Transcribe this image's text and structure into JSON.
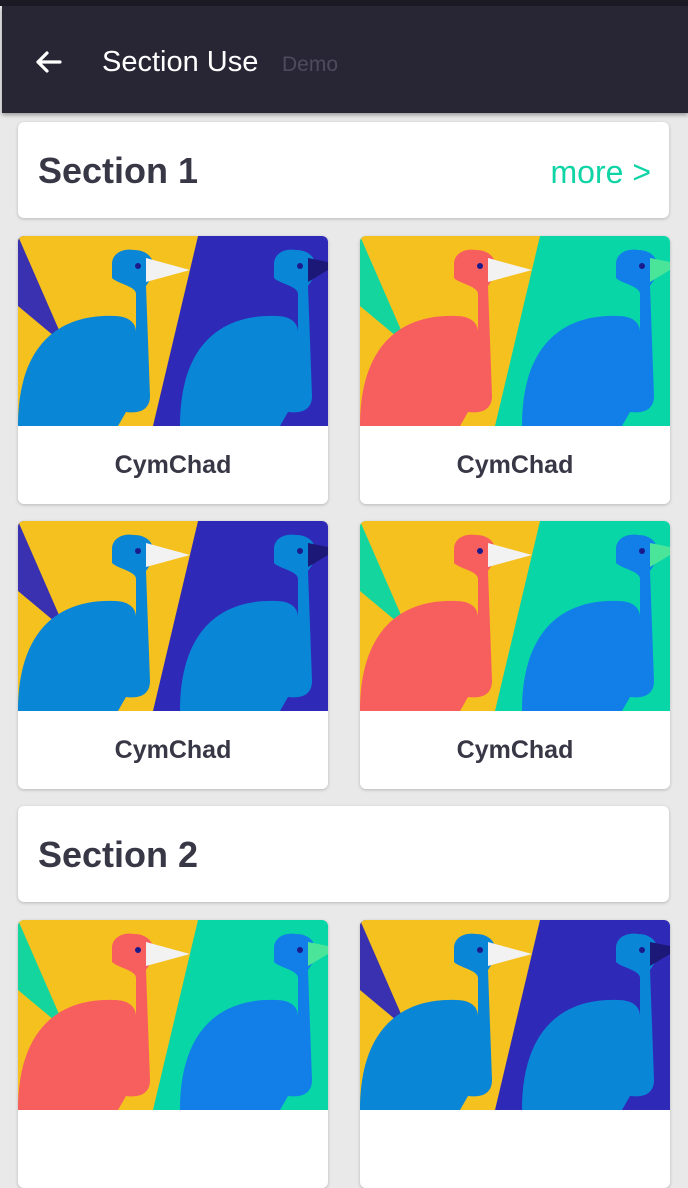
{
  "toolbar": {
    "title": "Section Use",
    "subtitle": "Demo"
  },
  "sections": [
    {
      "title": "Section 1",
      "more_label": "more >",
      "items": [
        {
          "label": "CymChad",
          "variant": "blue"
        },
        {
          "label": "CymChad",
          "variant": "teal"
        },
        {
          "label": "CymChad",
          "variant": "blue"
        },
        {
          "label": "CymChad",
          "variant": "teal"
        }
      ]
    },
    {
      "title": "Section 2",
      "items": [
        {
          "variant": "teal"
        },
        {
          "variant": "blue"
        }
      ]
    }
  ],
  "illustration_palettes": {
    "blue": {
      "corner": "#2f29b8",
      "left_bg": "#f5c11e",
      "right_bg": "#2f29b8",
      "left_bird": "#0a86d6",
      "right_bird": "#0a86d6",
      "beak_right": "#1c1878"
    },
    "teal": {
      "corner": "#08d6a6",
      "left_bg": "#f5c11e",
      "right_bg": "#08d6a6",
      "left_bird": "#f75f5f",
      "right_bird": "#127fe8",
      "beak_right": "#4be59a"
    }
  }
}
